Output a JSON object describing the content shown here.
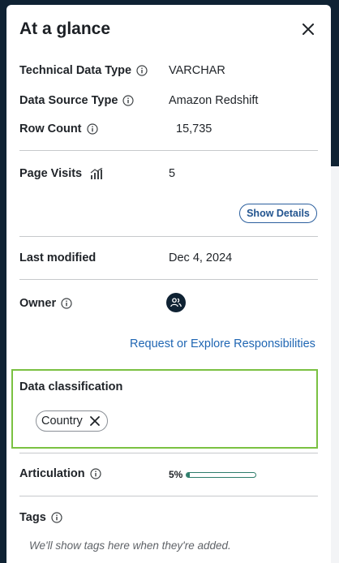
{
  "panel": {
    "title": "At a glance",
    "close_icon": "close-icon"
  },
  "details": {
    "technical_data_type": {
      "label": "Technical Data Type",
      "value": "VARCHAR"
    },
    "data_source_type": {
      "label": "Data Source Type",
      "value": "Amazon Redshift"
    },
    "row_count": {
      "label": "Row Count",
      "value": "15,735"
    },
    "page_visits": {
      "label": "Page Visits",
      "value": "5",
      "icon": "bar-chart-icon"
    },
    "show_details_label": "Show Details",
    "last_modified": {
      "label": "Last modified",
      "value": "Dec 4, 2024"
    },
    "owner": {
      "label": "Owner",
      "avatar_icon": "group-icon"
    },
    "responsibilities_link": "Request or Explore Responsibilities",
    "data_classification": {
      "label": "Data classification",
      "chips": [
        "Country"
      ]
    },
    "articulation": {
      "label": "Articulation",
      "percent_text": "5%",
      "progress": 0.05
    },
    "tags": {
      "label": "Tags",
      "empty_text": "We'll show tags here when they're added."
    }
  },
  "colors": {
    "background": "#0f2233",
    "link": "#1f66b3",
    "highlight_border": "#7ac142",
    "progress": "#2e7d6b"
  }
}
